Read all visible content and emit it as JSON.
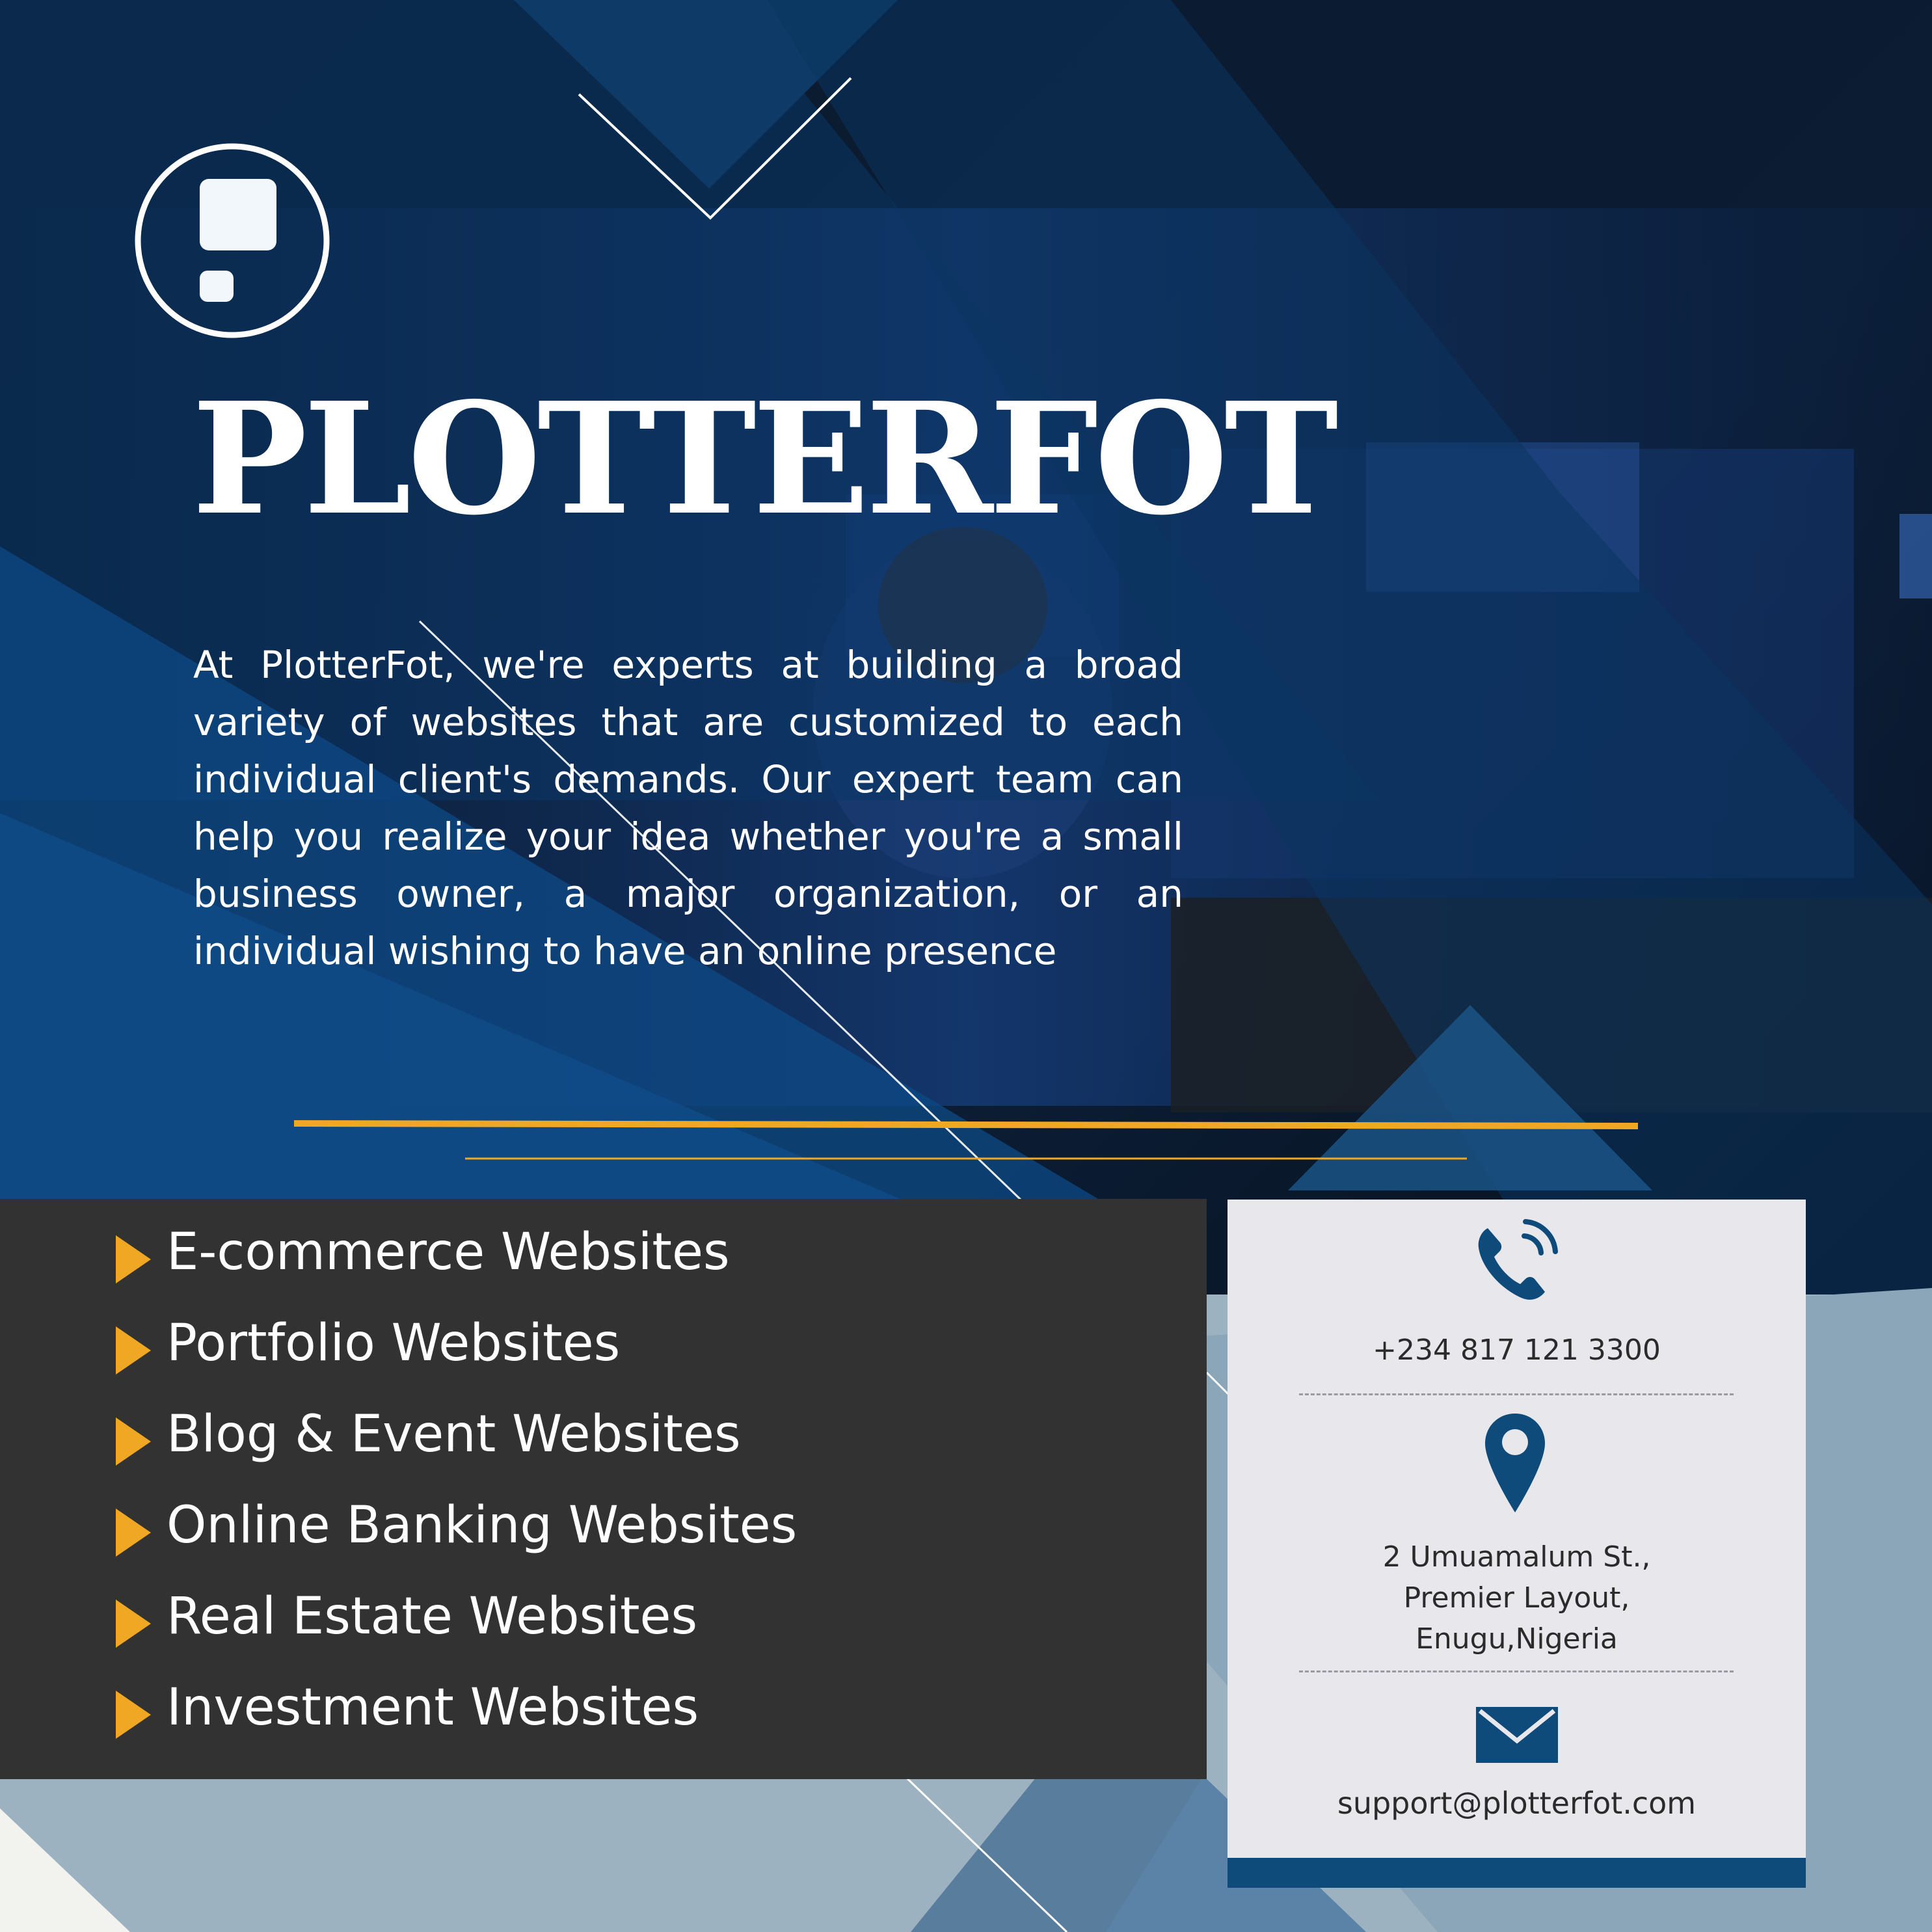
{
  "brand": {
    "name": "PLOTTERFOT",
    "intro": "At PlotterFot, we're experts at building a broad variety of websites that are customized to each individual client's demands. Our expert team can help you realize your idea whether you're a small business owner, a major organization, or an individual wishing to have an online presence"
  },
  "services": [
    "E-commerce Websites",
    "Portfolio Websites",
    "Blog & Event Websites",
    "Online Banking Websites",
    "Real Estate Websites",
    "Investment Websites"
  ],
  "contact": {
    "phone": "+234 817 121 3300",
    "address_lines": [
      "2 Umuamalum St.,",
      "Premier Layout,",
      "Enugu,Nigeria"
    ],
    "email": "support@plotterfot.com"
  },
  "colors": {
    "accent": "#f0a824",
    "navy": "#0e4a7a",
    "panel": "#323232",
    "card": "#e8e8ec"
  },
  "icons": {
    "logo": "exclamation-circle-logo",
    "phone": "phone-ringing-icon",
    "location": "map-pin-icon",
    "email": "envelope-icon",
    "bullet": "triangle-bullet-icon"
  }
}
